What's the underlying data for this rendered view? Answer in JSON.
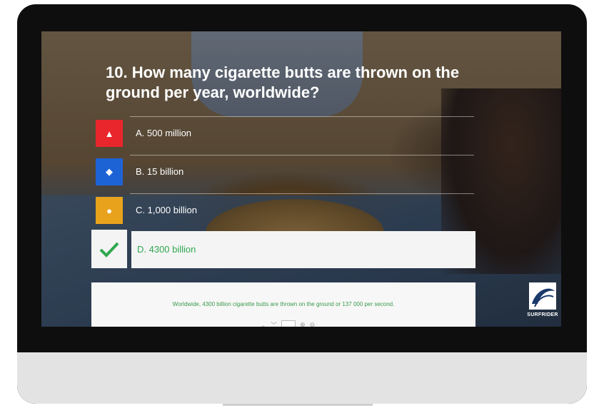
{
  "quiz": {
    "question": "10. How many cigarette butts are thrown on the ground per year, worldwide?",
    "answers": [
      {
        "label": "A. 500 million",
        "icon": "triangle-icon",
        "color": "#e8262c"
      },
      {
        "label": "B. 15 billion",
        "icon": "diamond-icon",
        "color": "#1e63d6"
      },
      {
        "label": "C. 1,000 billion",
        "icon": "circle-icon",
        "color": "#e8a21c"
      },
      {
        "label": "D. 4300 billion",
        "icon": "check-icon",
        "color": "#2fa84f"
      }
    ],
    "explanation": "Worldwide, 4300 billion cigarette butts are thrown on the ground or 137 000 per second.",
    "logo_text": "SURFRIDER"
  }
}
